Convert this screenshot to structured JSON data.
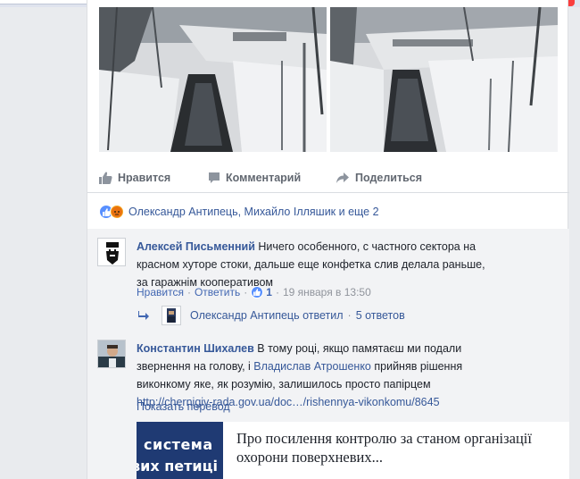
{
  "post": {
    "actions": {
      "like": "Нравится",
      "comment": "Комментарий",
      "share": "Поделиться"
    },
    "reactions_text": "Олександр Антипець, Михайло Ілляшик и еще 2"
  },
  "comments": [
    {
      "author": "Алексей Письменний",
      "text": "Ничего особенного, с частного сектора на красном хуторе стоки, дальше еще конфетка слив делала раньше, за гаражнім кооперативом",
      "like_label": "Нравится",
      "reply_label": "Ответить",
      "reaction_count": "1",
      "timestamp": "19 января в 13:50",
      "reply_summary": {
        "author_action": "Олександр Антипець ответил",
        "count": "5 ответов"
      }
    },
    {
      "author": "Константин Шихалев",
      "text_before": "В тому році, якщо памятаєш ми подали звернення на голову, і ",
      "mention": "Владислав Атрошенко",
      "text_after": " прийняв рішення виконкому яке, як розумію, залишилось просто папірцем ",
      "url": "http://chernigiv-rada.gov.ua/doc…/rishennya-vikonkomu/8645",
      "translate_label": "Показать перевод",
      "preview": {
        "image_line1": "система",
        "image_line2": "вих петиці",
        "title": "Про посилення контролю за станом організації охорони поверхневих..."
      }
    }
  ],
  "colors": {
    "link": "#365899",
    "muted": "#616770",
    "meta": "#90949c",
    "like_blue": "#5890ff",
    "angry": "#f5a623",
    "badge_red": "#fa3e3e"
  }
}
